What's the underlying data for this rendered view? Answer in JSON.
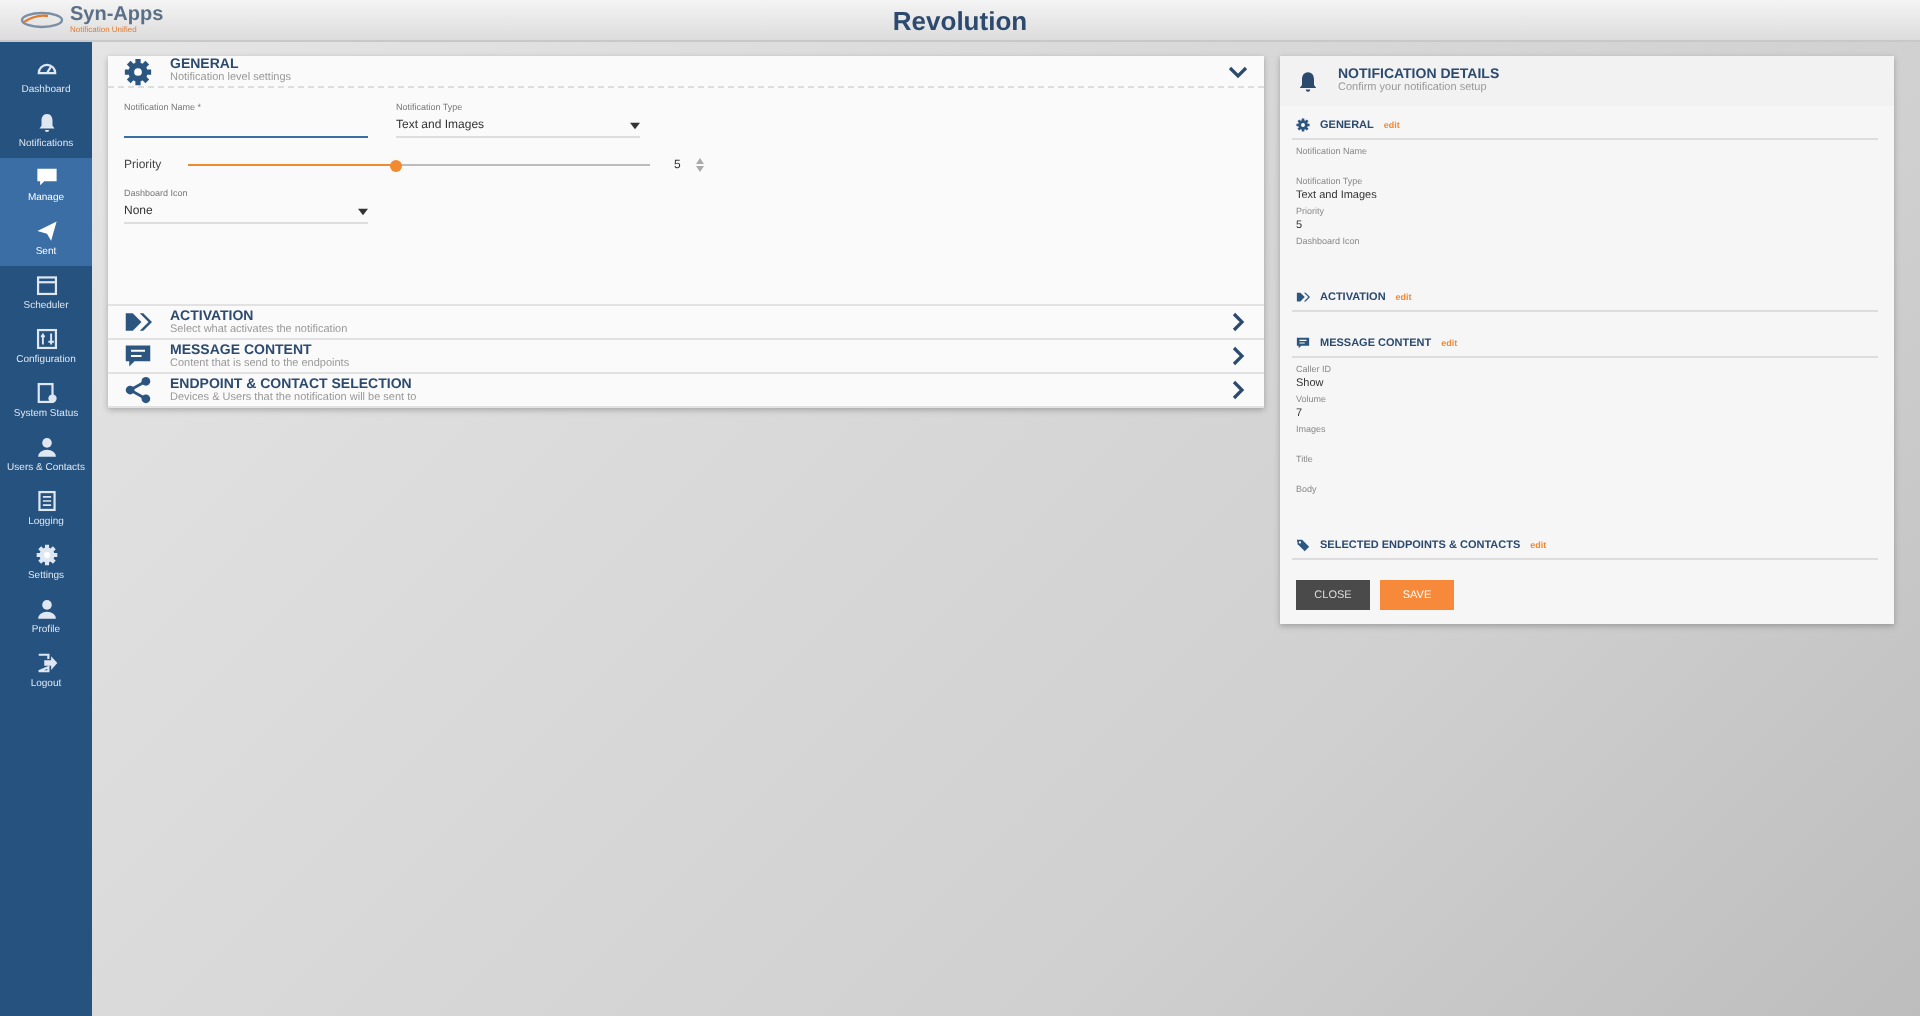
{
  "header": {
    "logo": "Syn-Apps",
    "logo_tagline": "Notification  Unified",
    "app_title": "Revolution"
  },
  "sidebar": {
    "items": [
      {
        "label": "Dashboard",
        "selected": false
      },
      {
        "label": "Notifications",
        "selected": false
      },
      {
        "label": "Manage",
        "selected": true
      },
      {
        "label": "Sent",
        "selected": true
      },
      {
        "label": "Scheduler",
        "selected": false
      },
      {
        "label": "Configuration",
        "selected": false
      },
      {
        "label": "System Status",
        "selected": false
      },
      {
        "label": "Users & Contacts",
        "selected": false
      },
      {
        "label": "Logging",
        "selected": false
      },
      {
        "label": "Settings",
        "selected": false
      },
      {
        "label": "Profile",
        "selected": false
      },
      {
        "label": "Logout",
        "selected": false
      }
    ]
  },
  "editor": {
    "sections": [
      {
        "title": "GENERAL",
        "subtitle": "Notification level settings",
        "expanded": true
      },
      {
        "title": "ACTIVATION",
        "subtitle": "Select what activates the notification",
        "expanded": false
      },
      {
        "title": "MESSAGE CONTENT",
        "subtitle": "Content that is send to the endpoints",
        "expanded": false
      },
      {
        "title": "ENDPOINT & CONTACT SELECTION",
        "subtitle": "Devices & Users that the notification will be sent to",
        "expanded": false
      }
    ],
    "general": {
      "name_field": {
        "label": "Notification Name *"
      },
      "type_field": {
        "label": "Notification Type",
        "value": "Text and Images"
      },
      "priority": {
        "label": "Priority",
        "level": 0.45,
        "value": "5"
      },
      "icon_field": {
        "label": "Dashboard Icon",
        "value": "None"
      }
    }
  },
  "details": {
    "title": "NOTIFICATION DETAILS",
    "subtitle": "Confirm your notification setup",
    "sections": [
      {
        "title": "GENERAL",
        "edit": "edit",
        "fields": [
          {
            "label": "Notification Name"
          },
          {
            "label": "Notification Type",
            "value": "Text and Images"
          },
          {
            "label": "Priority",
            "value": "5"
          },
          {
            "label": "Dashboard Icon"
          }
        ]
      },
      {
        "title": "ACTIVATION",
        "edit": "edit"
      },
      {
        "title": "MESSAGE CONTENT",
        "edit": "edit",
        "fields": [
          {
            "label": "Caller ID",
            "value": "Show"
          },
          {
            "label": "Volume",
            "value": "7"
          },
          {
            "label": "Images"
          },
          {
            "label": "Title"
          },
          {
            "label": "Body"
          }
        ]
      },
      {
        "title": "SELECTED ENDPOINTS & CONTACTS",
        "edit": "edit"
      }
    ],
    "buttons": [
      {
        "label": "CLOSE",
        "kind": "secondary"
      },
      {
        "label": "SAVE",
        "kind": "primary"
      }
    ]
  }
}
